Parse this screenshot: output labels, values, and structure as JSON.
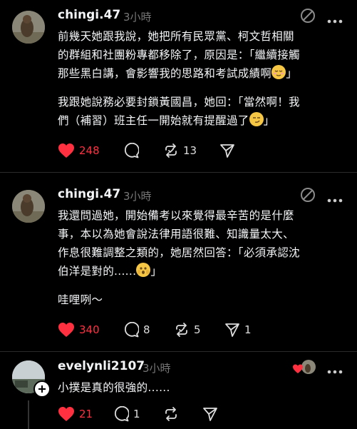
{
  "posts": [
    {
      "username": "chingi.47",
      "time": "3小時",
      "paragraphs": [
        [
          "前幾天她跟我說，她把所有民眾黨、柯文哲相關",
          "的群組和社團粉專都移除了，原因是：「繼續接觸",
          "那些黑白講，會影響我的思路和考試成績啊",
          "」"
        ],
        [
          "我跟她說務必要封鎖黃國昌，她回：「當然啊！我",
          "們（補習）班主任一開始就有提醒過了",
          "」"
        ]
      ],
      "actions": {
        "likes": "248",
        "comments": "",
        "reposts": "13",
        "shares": ""
      }
    },
    {
      "username": "chingi.47",
      "time": "3小時",
      "paragraphs": [
        [
          "我還問過她，開始備考以來覺得最辛苦的是什麼",
          "事，本以為她會說法律用語很難、知識量太大、",
          "作息很難調整之類的，她居然回答：「必須承認沈",
          "伯洋是對的......",
          "」"
        ],
        [
          "哇哩咧～"
        ]
      ],
      "actions": {
        "likes": "340",
        "comments": "8",
        "reposts": "5",
        "shares": "1"
      }
    },
    {
      "username": "evelynli2107",
      "time": "3小時",
      "paragraphs": [
        [
          "小撲是真的很強的......"
        ]
      ],
      "actions": {
        "likes": "21",
        "comments": "1",
        "reposts": "",
        "shares": ""
      }
    }
  ],
  "icons": {
    "like": "heart-icon",
    "comment": "comment-icon",
    "repost": "repost-icon",
    "share": "share-icon",
    "more": "more-icon",
    "translate": "translate-icon"
  },
  "colors": {
    "background": "#000000",
    "like": "#ff3040",
    "muted": "#777777"
  }
}
